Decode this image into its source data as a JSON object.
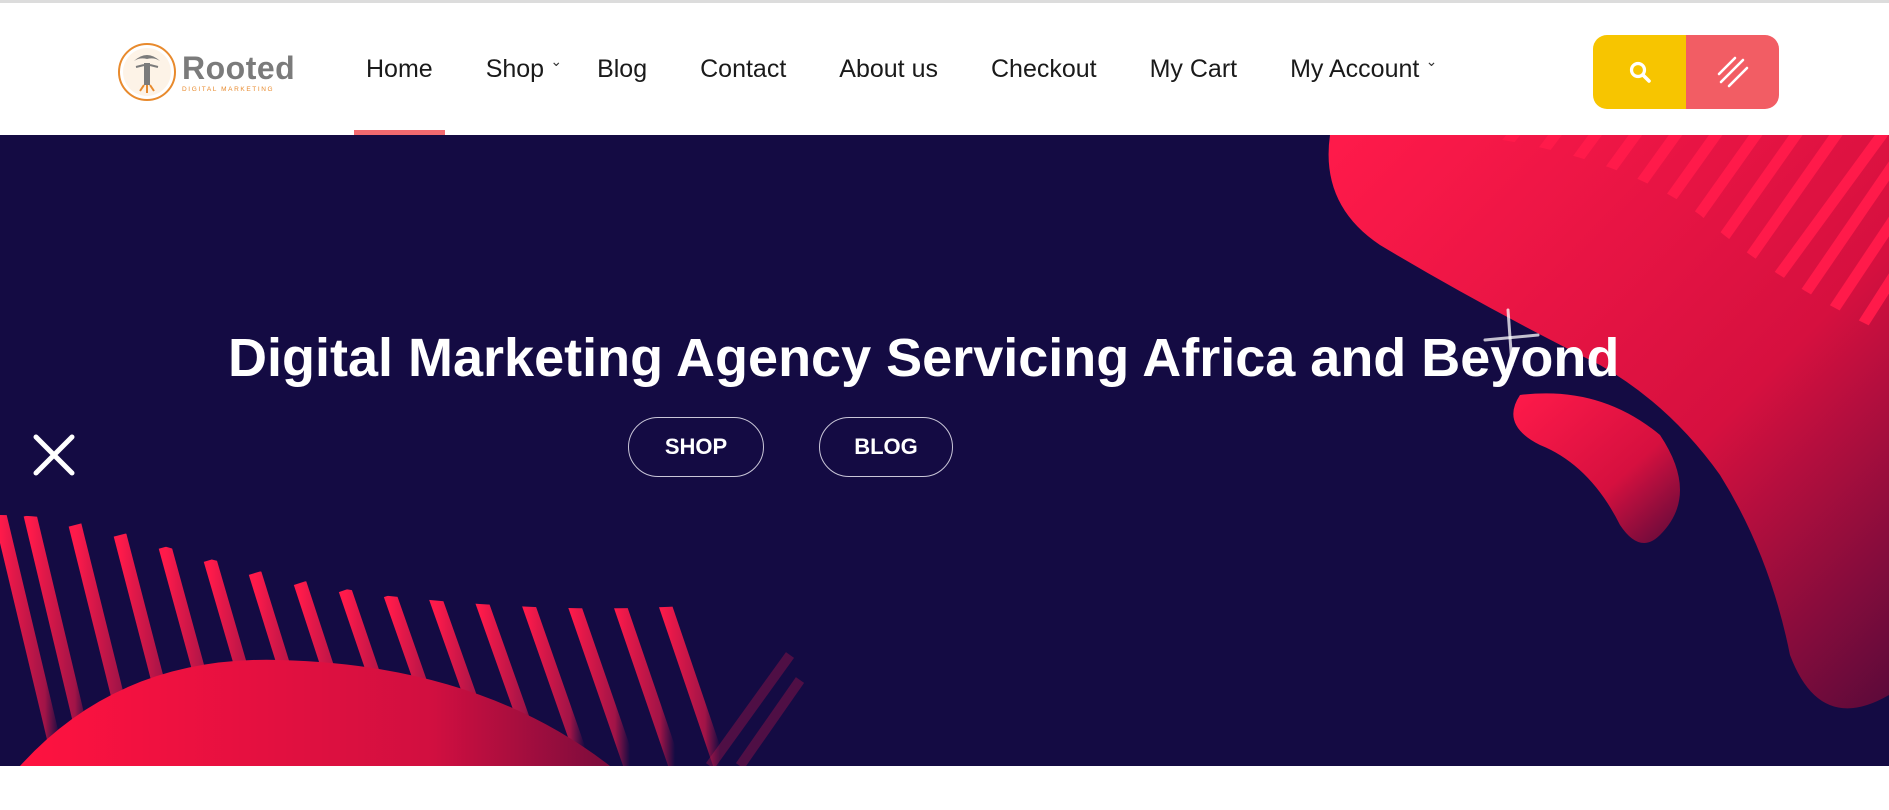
{
  "brand": {
    "name": "Rooted",
    "tagline": "DIGITAL MARKETING"
  },
  "nav": {
    "items": [
      {
        "label": "Home"
      },
      {
        "label": "Shop"
      },
      {
        "label": "Blog"
      },
      {
        "label": "Contact"
      },
      {
        "label": "About us"
      },
      {
        "label": "Checkout"
      },
      {
        "label": "My Cart"
      },
      {
        "label": "My Account"
      }
    ],
    "active": "Home"
  },
  "header_buttons": {
    "search_icon": "search-icon",
    "menu_icon": "hamburger-slash-icon"
  },
  "hero": {
    "title": "Digital Marketing Agency Servicing Africa and Beyond",
    "buttons": {
      "shop": "SHOP",
      "blog": "BLOG"
    },
    "close_icon": "close-icon"
  },
  "colors": {
    "hero_bg": "#140b43",
    "accent_pink": "#f0184a",
    "search_btn": "#f7c500",
    "menu_btn": "#f25d64",
    "active_underline": "#f26a70",
    "logo_orange": "#e88a2d"
  }
}
